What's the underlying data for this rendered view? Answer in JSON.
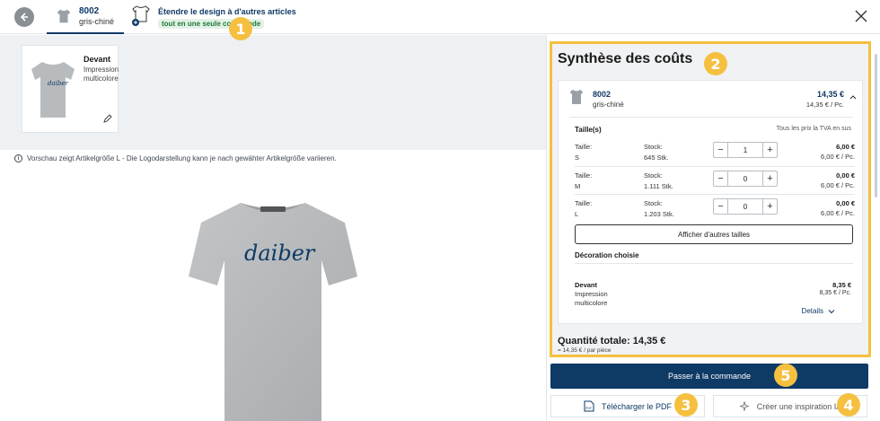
{
  "header": {
    "back_icon": "arrow-left-icon",
    "active_tab": {
      "code": "8002",
      "variant": "gris-chiné"
    },
    "extend": {
      "title": "Étendre le design à d'autres articles",
      "badge": "tout en une seule commande"
    },
    "close_icon": "close-icon"
  },
  "preview": {
    "thumb": {
      "title": "Devant",
      "desc": "Impression multicolore"
    },
    "info": "Vorschau zeigt Artikelgröße L - Die Logodarstellung kann je nach gewähter Artikelgröße variieren.",
    "logo_text": "daiber"
  },
  "summary": {
    "title": "Synthèse des coûts",
    "product": {
      "code": "8002",
      "variant": "gris-chiné",
      "price": "14,35 €",
      "unit_price": "14,35 € / Pc."
    },
    "sizes_label": "Taille(s)",
    "tva_note": "Tous les prix la TVA en sus",
    "rows": [
      {
        "size_label": "Taille:",
        "size": "S",
        "stock_label": "Stock:",
        "stock": "645 Stk.",
        "qty": "1",
        "total": "6,00 €",
        "unit": "6,00 € / Pc."
      },
      {
        "size_label": "Taille:",
        "size": "M",
        "stock_label": "Stock:",
        "stock": "1.111 Stk.",
        "qty": "0",
        "total": "0,00 €",
        "unit": "6,00 € / Pc."
      },
      {
        "size_label": "Taille:",
        "size": "L",
        "stock_label": "Stock:",
        "stock": "1.203 Stk.",
        "qty": "0",
        "total": "0,00 €",
        "unit": "6,00 € / Pc."
      }
    ],
    "more_sizes": "Afficher d'autres tailles",
    "decoration_label": "Décoration choisie",
    "decoration": {
      "name": "Devant",
      "desc": "Impression multicolore",
      "price": "8,35 €",
      "unit": "8,35 € / Pc."
    },
    "details": "Details",
    "total": "Quantité totale: 14,35 €",
    "total_sub": "= 14,35 € / par pièce"
  },
  "actions": {
    "order": "Passer à la commande",
    "pdf": "Télécharger le PDF",
    "ai": "Créer une inspiration IA"
  },
  "markers": [
    "1",
    "2",
    "3",
    "4",
    "5"
  ],
  "colors": {
    "accent": "#0e3a66",
    "highlight": "#f5c03f",
    "badge_bg": "#e3f1e6",
    "badge_text": "#1f7a36"
  }
}
